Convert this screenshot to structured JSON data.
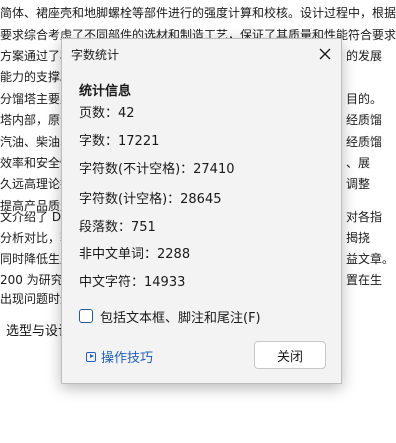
{
  "document": {
    "lines": [
      "简体、裙座壳和地脚螺栓等部件进行的强度计算和校核。设计过程中，根据石",
      "要求综合考虑了不同部件的选材和制造工艺，保证了其质量和性能符合要求。最",
      "方案通过了校核",
      "能力的支撑。",
      "分馏塔主要用于",
      "塔内部，原油及",
      "汽油、柴油、煤",
      "效率和安全性，",
      "久远高理论扰动",
      "提高产品质量，",
      "文介绍了 DN1",
      "分析对比，获得",
      "同时降低生产成",
      "200 为研究对",
      "出现问题时无"
    ],
    "right_fragments": [
      "的发展",
      "目的。",
      "经质馏",
      "经质馏",
      "、展",
      "调整",
      "对各指",
      "揭挠",
      "益文章。",
      "置在生"
    ],
    "heading": "选型与设计"
  },
  "dialog": {
    "title": "字数统计",
    "section_title": "统计信息",
    "stats": [
      "页数：42",
      "字数：17221",
      "字符数(不计空格)：27410",
      "字符数(计空格)：28645",
      "段落数：751",
      "非中文单词：2288",
      "中文字符：14933"
    ],
    "checkbox_label": "包括文本框、脚注和尾注(F)",
    "checkbox_checked": false,
    "tips_label": "操作技巧",
    "close_button_label": "关闭",
    "close_icon": "close-icon",
    "accent_color": "#1f5fbf"
  }
}
